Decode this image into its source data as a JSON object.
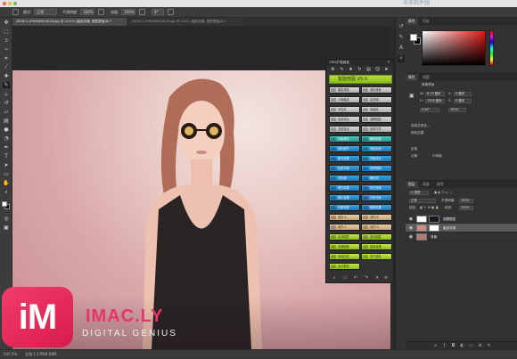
{
  "watermark": {
    "text": "未来软件园",
    "sub": "www.mfsoft.com"
  },
  "options": {
    "mode_label": "模式:",
    "mode_value": "正常",
    "opacity_label": "不透明度:",
    "opacity_value": "100%",
    "flow_label": "流量:",
    "flow_value": "100%",
    "angle_value": "0°"
  },
  "tabs": [
    {
      "label": "2878:0-1f9f4f89f23026.jpg @ 24.5% (磨皮效果, 图层蒙版/8) *"
    },
    {
      "label": "2878:0-1f9f4f89f23026.jpg @ 100% (磨皮效果, 图层蒙版/8) *"
    }
  ],
  "plugin": {
    "title": "DR5扩展面板",
    "banner": "智能修图 V5.0",
    "rows": [
      {
        "left": {
          "label": "磨皮调色",
          "style": "grey"
        },
        "right": {
          "label": "液化瘦身",
          "style": "grey"
        }
      },
      {
        "left": {
          "label": "人像磨皮",
          "style": "grey"
        },
        "right": {
          "label": "高低频",
          "style": "grey"
        }
      },
      {
        "left": {
          "label": "中性灰",
          "style": "grey"
        },
        "right": {
          "label": "双曲线",
          "style": "grey"
        }
      },
      {
        "left": {
          "label": "加深减淡",
          "style": "grey"
        },
        "right": {
          "label": "观察图层",
          "style": "grey"
        }
      },
      {
        "left": {
          "label": "去除斑点",
          "style": "grey"
        },
        "right": {
          "label": "皮肤平滑",
          "style": "grey"
        }
      },
      {
        "left": {
          "label": "牙齿美白",
          "style": "teal"
        },
        "right": {
          "label": "眼睛增强",
          "style": "teal"
        }
      },
      {
        "left": {
          "label": "锐化细节",
          "style": "blue"
        },
        "right": {
          "label": "添加杂色",
          "style": "blue"
        }
      },
      {
        "left": {
          "label": "柔光效果",
          "style": "blue"
        },
        "right": {
          "label": "亮度对比",
          "style": "blue"
        }
      },
      {
        "left": {
          "label": "色彩平衡",
          "style": "blue"
        },
        "right": {
          "label": "自然饱和",
          "style": "blue"
        }
      },
      {
        "left": {
          "label": "冷色调",
          "style": "blue"
        },
        "right": {
          "label": "暖色调",
          "style": "blue"
        }
      },
      {
        "left": {
          "label": "黑白效果",
          "style": "blue"
        },
        "right": {
          "label": "复古色调",
          "style": "blue"
        }
      },
      {
        "left": {
          "label": "胶片效果",
          "style": "blue"
        },
        "right": {
          "label": "日系清新",
          "style": "blue"
        }
      },
      {
        "left": {
          "label": "光晕效果",
          "style": "blue"
        },
        "right": {
          "label": "暗角效果",
          "style": "blue"
        }
      },
      {
        "left": {
          "label": "动作 A",
          "style": "tan"
        },
        "right": {
          "label": "动作 B",
          "style": "tan"
        }
      },
      {
        "left": {
          "label": "动作 C",
          "style": "tan"
        },
        "right": {
          "label": "动作 D",
          "style": "tan"
        }
      },
      {
        "left": {
          "label": "合并图层",
          "style": "lime"
        },
        "right": {
          "label": "盖印图层",
          "style": "lime"
        }
      },
      {
        "left": {
          "label": "存储图像",
          "style": "lime"
        },
        "right": {
          "label": "批量处理",
          "style": "lime"
        }
      },
      {
        "left": {
          "label": "清除历史",
          "style": "lime"
        },
        "right": {
          "label": "关于插件",
          "style": "lime"
        }
      }
    ],
    "extra_button": {
      "label": "自动更新",
      "style": "lime"
    }
  },
  "panels": {
    "color_tabs": [
      "颜色",
      "色板"
    ],
    "props_tabs": [
      "属性",
      "调整"
    ],
    "props": {
      "mask_label": "像素蒙版",
      "w_label": "W:",
      "w_value": "8.13 厘米",
      "h_label": "H:",
      "h_value": "1308 厘米",
      "x_label": "X:",
      "x_value": "0 厘米",
      "y_label": "Y:",
      "y_value": "0 厘米",
      "density_label": "0.00°",
      "feather_value": "100%",
      "refine_label": "选择并遮住...",
      "color_range_label": "颜色范围",
      "invert_label": "反相",
      "edge_label": "边缘",
      "edge2_label": "中间值"
    },
    "layers_tabs": [
      "图层",
      "通道",
      "路径"
    ],
    "layers_kind": "Q 类型",
    "blend_mode": "正常",
    "opacity_label": "不透明度:",
    "opacity_value": "100%",
    "lock_label": "锁定:",
    "fill_label": "填充:",
    "fill_value": "100%",
    "layers": [
      {
        "name": "观察图层",
        "selected": false
      },
      {
        "name": "磨皮效果",
        "selected": true
      },
      {
        "name": "背景",
        "selected": false
      }
    ]
  },
  "status": {
    "zoom": "245.5%",
    "doc": "文档:1.17M/4.68M"
  },
  "brand": {
    "logo": "iM",
    "name": "IMAC.LY",
    "tagline": "DIGITAL GENIUS",
    "accent": "#e8356a"
  },
  "colors": {
    "plugin_lime": "#a6cf33",
    "plugin_blue": "#2b8dcc",
    "plugin_teal": "#35b2ad"
  }
}
